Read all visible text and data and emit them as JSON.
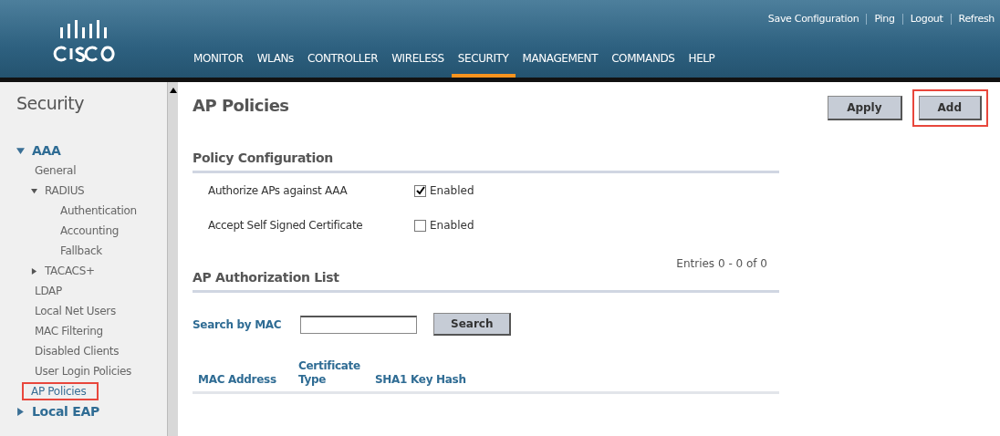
{
  "header": {
    "top_links": [
      "Save Configuration",
      "Ping",
      "Logout",
      "Refresh"
    ],
    "nav": [
      {
        "label": "MONITOR",
        "selected": false
      },
      {
        "label": "WLANs",
        "selected": false
      },
      {
        "label": "CONTROLLER",
        "selected": false
      },
      {
        "label": "WIRELESS",
        "selected": false
      },
      {
        "label": "SECURITY",
        "selected": true
      },
      {
        "label": "MANAGEMENT",
        "selected": false
      },
      {
        "label": "COMMANDS",
        "selected": false
      },
      {
        "label": "HELP",
        "selected": false
      }
    ]
  },
  "sidebar": {
    "title": "Security",
    "items": [
      {
        "label": "AAA",
        "expanded": true,
        "highlighted": false,
        "children": [
          {
            "label": "General",
            "highlighted": false
          },
          {
            "label": "RADIUS",
            "expanded": true,
            "highlighted": false,
            "children": [
              {
                "label": "Authentication",
                "highlighted": false
              },
              {
                "label": "Accounting",
                "highlighted": false
              },
              {
                "label": "Fallback",
                "highlighted": false
              }
            ]
          },
          {
            "label": "TACACS+",
            "expanded": false,
            "highlighted": false
          },
          {
            "label": "LDAP",
            "highlighted": false
          },
          {
            "label": "Local Net Users",
            "highlighted": false
          },
          {
            "label": "MAC Filtering",
            "highlighted": false
          },
          {
            "label": "Disabled Clients",
            "highlighted": false
          },
          {
            "label": "User Login Policies",
            "highlighted": false
          },
          {
            "label": "AP Policies",
            "highlighted": true
          }
        ]
      },
      {
        "label": "Local EAP",
        "expanded": false,
        "highlighted": false
      }
    ]
  },
  "page": {
    "title": "AP Policies",
    "buttons": [
      {
        "label": "Apply",
        "highlighted": false
      },
      {
        "label": "Add",
        "highlighted": true
      }
    ],
    "policy_section": "Policy Configuration",
    "policies": [
      {
        "label": "Authorize APs against AAA",
        "option": "Enabled",
        "checked": true
      },
      {
        "label": "Accept Self Signed Certificate",
        "option": "Enabled",
        "checked": false
      }
    ],
    "list_section": "AP Authorization List",
    "entries": "Entries 0 - 0 of 0",
    "search": {
      "label": "Search by MAC",
      "button": "Search"
    },
    "table": {
      "columns": [
        "MAC Address",
        "Certificate Type",
        "SHA1 Key Hash"
      ]
    }
  }
}
